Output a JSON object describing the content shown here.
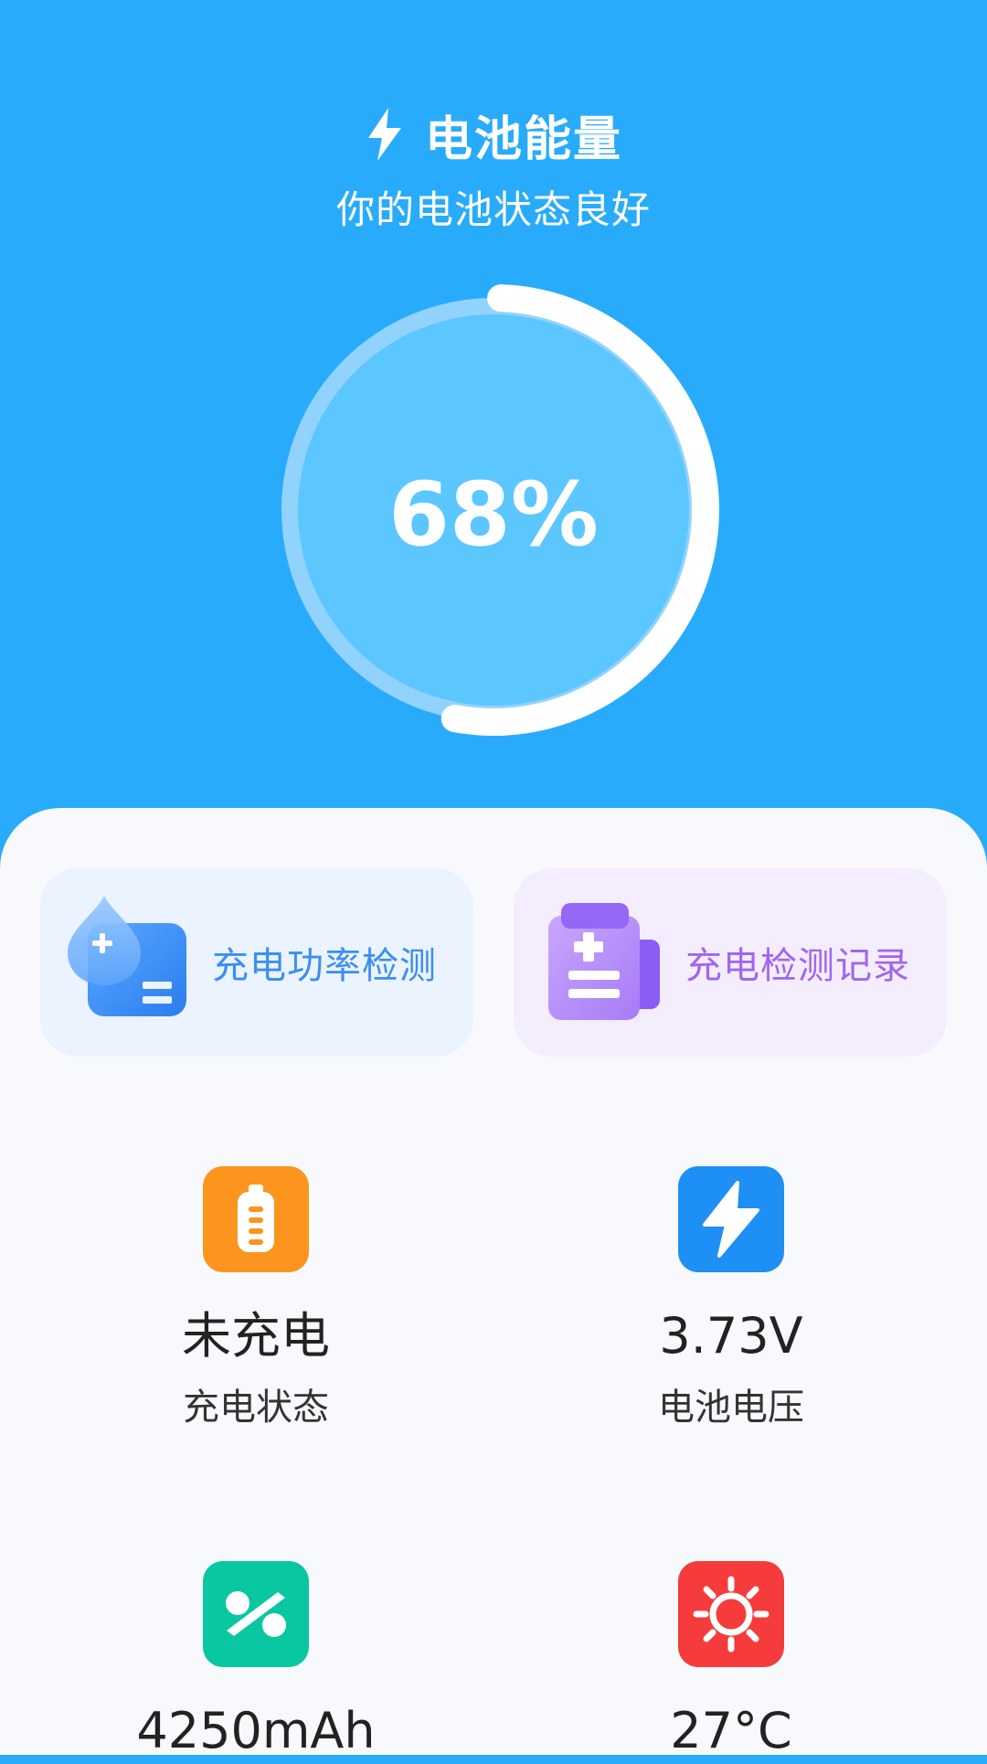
{
  "header": {
    "title": "电池能量",
    "subtitle": "你的电池状态良好",
    "title_icon": "lightning-bolt-icon"
  },
  "gauge": {
    "percent_text": "68%",
    "level": 0.68
  },
  "features": [
    {
      "label": "充电功率检测",
      "icon": "water-drop-battery-icon",
      "color": "#3a8ef4"
    },
    {
      "label": "充电检测记录",
      "icon": "clipboard-battery-icon",
      "color": "#a065f0"
    }
  ],
  "stats": [
    {
      "value": "未充电",
      "label": "充电状态",
      "icon": "battery-icon",
      "color": "#fb951e"
    },
    {
      "value": "3.73V",
      "label": "电池电压",
      "icon": "lightning-icon",
      "color": "#1e8ff5"
    },
    {
      "value": "4250mAh",
      "label": "",
      "icon": "percent-icon",
      "color": "#08c7a1"
    },
    {
      "value": "27°C",
      "label": "",
      "icon": "sun-icon",
      "color": "#f53b3b"
    }
  ],
  "colors": {
    "header_bg": "#29abfb",
    "panel_bg": "#f8f9fd"
  }
}
